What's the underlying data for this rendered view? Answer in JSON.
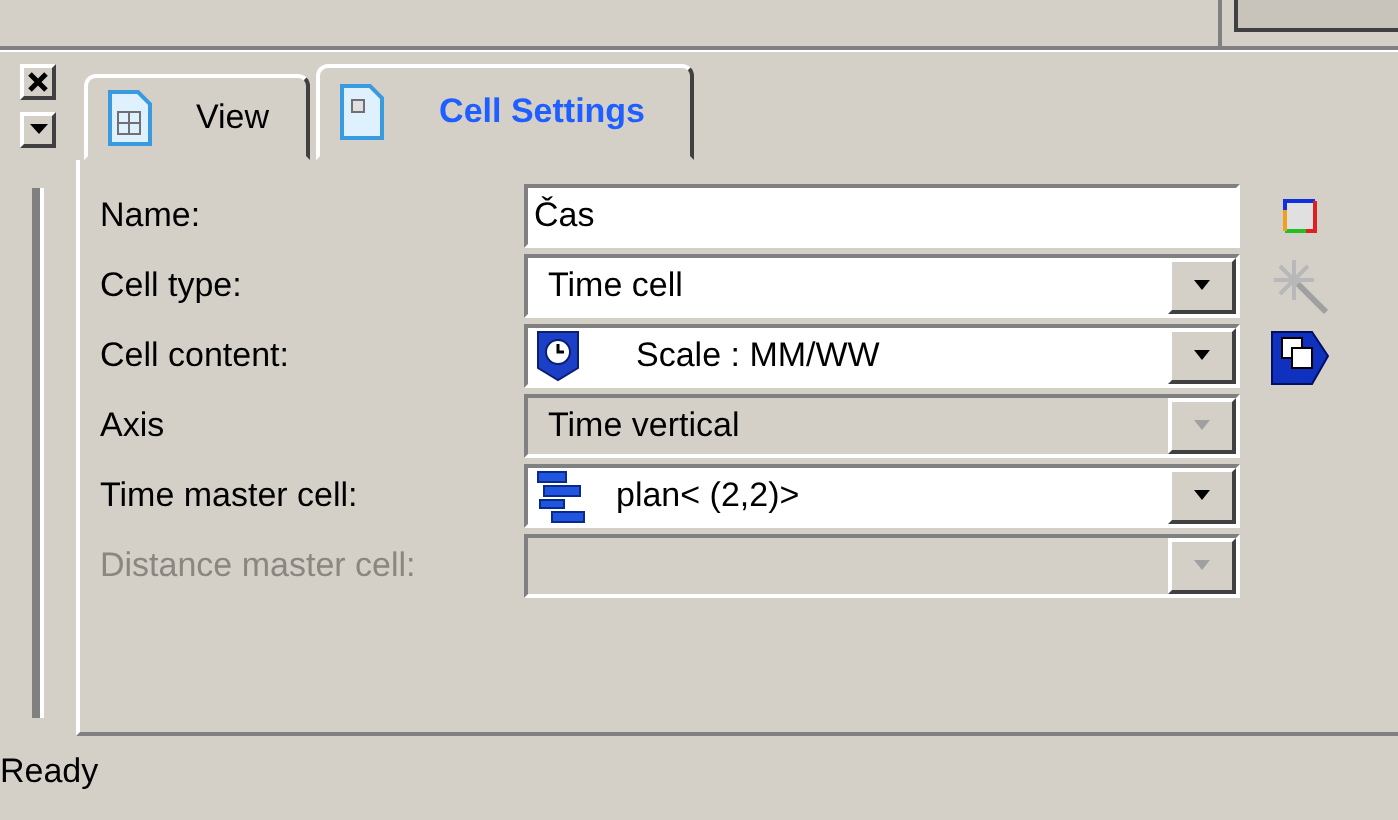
{
  "tabs": [
    {
      "label": "View",
      "selected": false
    },
    {
      "label": "Cell Settings",
      "selected": true
    }
  ],
  "fields": [
    {
      "label": "Name:",
      "kind": "text",
      "value": "Čas",
      "disabled": false,
      "label_disabled": false
    },
    {
      "label": "Cell type:",
      "kind": "combo",
      "value": "Time cell",
      "disabled": false,
      "label_disabled": false
    },
    {
      "label": "Cell content:",
      "kind": "combo",
      "value": "Scale  : MM/WW",
      "disabled": false,
      "label_disabled": false
    },
    {
      "label": "Axis",
      "kind": "combo",
      "value": "Time vertical",
      "disabled": true,
      "label_disabled": false
    },
    {
      "label": "Time master cell:",
      "kind": "combo",
      "value": "plan< (2,2)>",
      "disabled": false,
      "label_disabled": false
    },
    {
      "label": "Distance master cell:",
      "kind": "combo",
      "disabled": true,
      "label_disabled": true
    }
  ],
  "status_bar": "Ready"
}
